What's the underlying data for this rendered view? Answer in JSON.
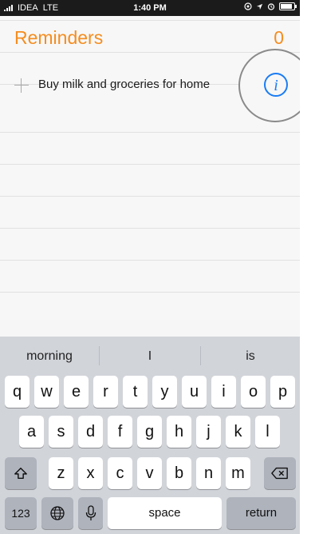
{
  "status_bar": {
    "carrier": "IDEA",
    "network": "LTE",
    "time": "1:40 PM",
    "battery_level": 0.9
  },
  "reminders": {
    "title": "Reminders",
    "count": "0",
    "items": [
      {
        "text": "Buy milk and groceries for home"
      }
    ]
  },
  "keyboard": {
    "suggestions": [
      "morning",
      "I",
      "is"
    ],
    "row1": [
      "q",
      "w",
      "e",
      "r",
      "t",
      "y",
      "u",
      "i",
      "o",
      "p"
    ],
    "row2": [
      "a",
      "s",
      "d",
      "f",
      "g",
      "h",
      "j",
      "k",
      "l"
    ],
    "row3": [
      "z",
      "x",
      "c",
      "v",
      "b",
      "n",
      "m"
    ],
    "space_label": "space",
    "return_label": "return",
    "numbers_label": "123"
  },
  "colors": {
    "accent": "#f58d20",
    "info": "#1a7cf5"
  },
  "icons": {
    "info": "info-icon",
    "shift": "shift-icon",
    "delete": "backspace-icon",
    "globe": "globe-icon",
    "mic": "microphone-icon"
  }
}
